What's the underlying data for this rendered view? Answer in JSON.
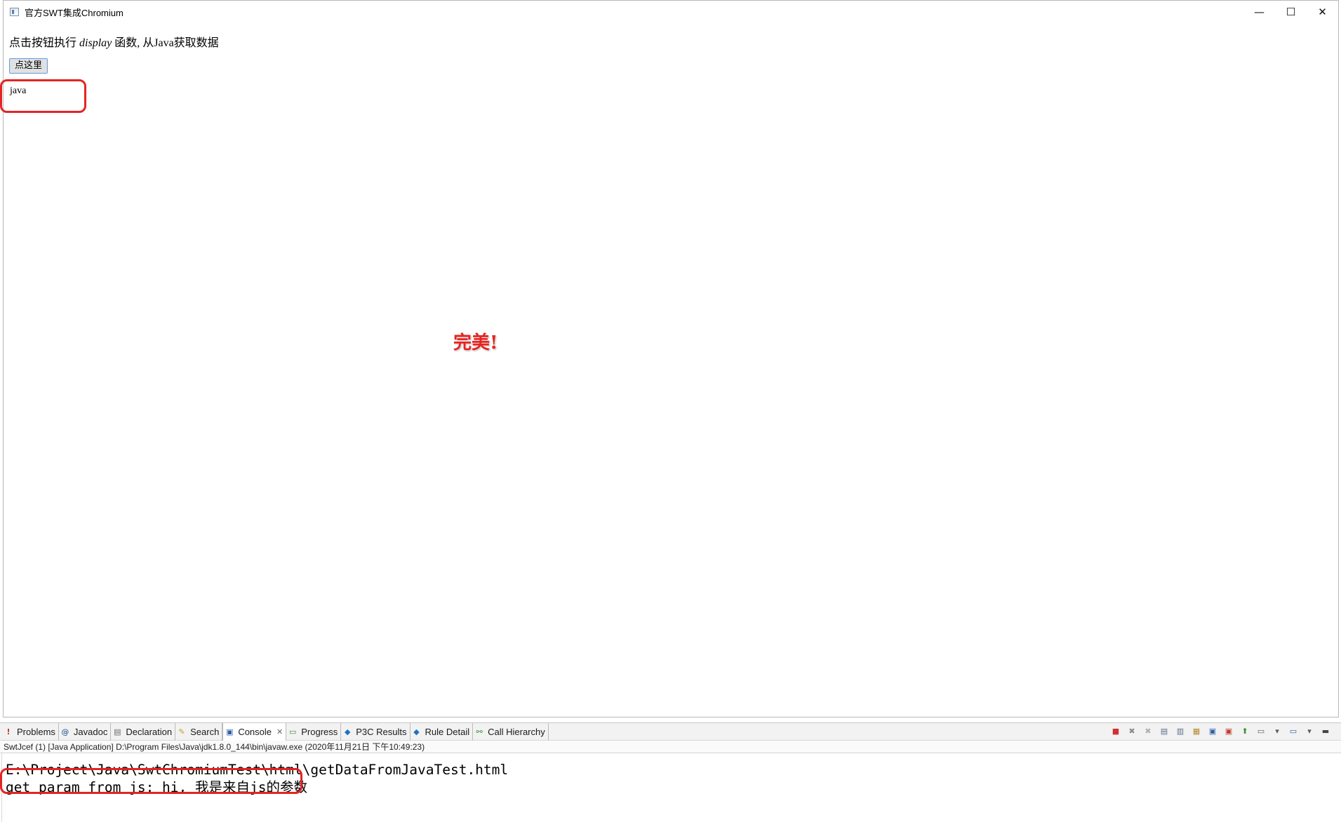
{
  "window": {
    "title": "官方SWT集成Chromium",
    "controls": {
      "minimize": "—",
      "maximize": "☐",
      "close": "✕"
    }
  },
  "page": {
    "instruction_prefix": "点击按钮执行 ",
    "instruction_code": "display",
    "instruction_suffix": " 函数, 从Java获取数据",
    "button_label": "点这里",
    "result_text": "java"
  },
  "annotation": {
    "text": "完美!",
    "color": "#e8231f"
  },
  "eclipse": {
    "tabs": [
      {
        "label": "Problems",
        "icon": "problems-icon",
        "glyph": "!",
        "color": "#c0392b"
      },
      {
        "label": "Javadoc",
        "icon": "javadoc-icon",
        "glyph": "@",
        "color": "#4a6fa5"
      },
      {
        "label": "Declaration",
        "icon": "declaration-icon",
        "glyph": "▤",
        "color": "#6b6b6b"
      },
      {
        "label": "Search",
        "icon": "search-icon",
        "glyph": "✎",
        "color": "#c9a227"
      },
      {
        "label": "Console",
        "icon": "console-icon",
        "glyph": "▣",
        "color": "#2f5fa8",
        "active": true
      },
      {
        "label": "Progress",
        "icon": "progress-icon",
        "glyph": "▭",
        "color": "#3b8f3b"
      },
      {
        "label": "P3C Results",
        "icon": "p3c-icon",
        "glyph": "◆",
        "color": "#1e73be"
      },
      {
        "label": "Rule Detail",
        "icon": "rule-detail-icon",
        "glyph": "◆",
        "color": "#1e73be"
      },
      {
        "label": "Call Hierarchy",
        "icon": "call-hierarchy-icon",
        "glyph": "⚯",
        "color": "#3b8f3b"
      }
    ],
    "console_status": "SwtJcef (1) [Java Application] D:\\Program Files\\Java\\jdk1.8.0_144\\bin\\javaw.exe (2020年11月21日 下午10:49:23)",
    "console_lines": [
      "E:\\Project\\Java\\SwtChromiumTest\\html\\getDataFromJavaTest.html",
      "get param from js: hi, 我是来自js的参数"
    ],
    "toolbar": [
      {
        "icon": "terminate-icon",
        "glyph": "■",
        "color": "#d32f2f"
      },
      {
        "icon": "remove-launch-icon",
        "glyph": "✖",
        "color": "#8a8a8a"
      },
      {
        "icon": "remove-all-icon",
        "glyph": "✖",
        "color": "#b0b0b0"
      },
      {
        "icon": "clear-console-icon",
        "glyph": "▤",
        "color": "#5a6f8f"
      },
      {
        "icon": "scroll-lock-icon",
        "glyph": "▥",
        "color": "#5a6f8f"
      },
      {
        "icon": "word-wrap-icon",
        "glyph": "▦",
        "color": "#b58b2a"
      },
      {
        "icon": "show-on-output-icon",
        "glyph": "▣",
        "color": "#2f5fa8"
      },
      {
        "icon": "show-on-error-icon",
        "glyph": "▣",
        "color": "#c0392b"
      },
      {
        "icon": "pin-console-icon",
        "glyph": "⬆",
        "color": "#3b8f3b"
      },
      {
        "icon": "display-console-icon",
        "glyph": "▭",
        "color": "#5a5a5a"
      },
      {
        "icon": "display-dropdown-icon",
        "glyph": "▾",
        "color": "#5a5a5a"
      },
      {
        "icon": "new-console-icon",
        "glyph": "▭",
        "color": "#2f5fa8"
      },
      {
        "icon": "new-console-dropdown-icon",
        "glyph": "▾",
        "color": "#5a5a5a"
      },
      {
        "icon": "minimize-view-icon",
        "glyph": "▬",
        "color": "#444444"
      }
    ]
  }
}
